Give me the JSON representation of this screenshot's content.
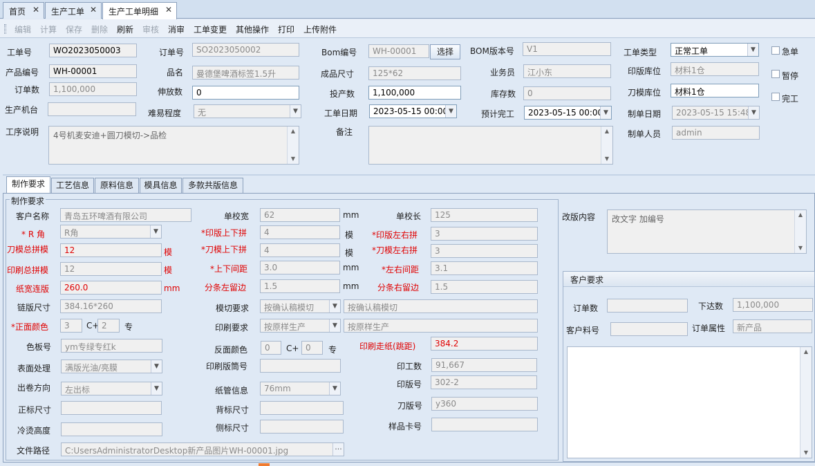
{
  "tabs": [
    {
      "label": "首页",
      "close": "✕"
    },
    {
      "label": "生产工单",
      "close": "✕"
    },
    {
      "label": "生产工单明细",
      "close": "✕"
    }
  ],
  "toolbar": {
    "edit": "编辑",
    "calc": "计算",
    "save": "保存",
    "delete": "删除",
    "refresh": "刷新",
    "audit": "审核",
    "unaudit": "消审",
    "change": "工单变更",
    "other": "其他操作",
    "print": "打印",
    "upload": "上传附件"
  },
  "header": {
    "order_no_label": "工单号",
    "order_no": "WO2023050003",
    "sale_order_label": "订单号",
    "sale_order": "SO2023050002",
    "bom_no_label": "Bom编号",
    "bom_no": "WH-00001",
    "select_button": "选择",
    "bom_version_label": "BOM版本号",
    "bom_version": "V1",
    "order_type_label": "工单类型",
    "order_type": "正常工单",
    "urgent_label": "急单",
    "pause_label": "暂停",
    "done_label": "完工",
    "product_no_label": "产品编号",
    "product_no": "WH-00001",
    "product_name_label": "品名",
    "product_name": "曼德堡啤酒标签1.5升",
    "finish_size_label": "成品尺寸",
    "finish_size": "125*62",
    "salesman_label": "业务员",
    "salesman": "江小东",
    "print_warehouse_label": "印版库位",
    "print_warehouse": "材料1仓",
    "order_qty_label": "订单数",
    "order_qty": "1,100,000",
    "extra_qty_label": "伸放数",
    "extra_qty": "0",
    "produce_qty_label": "投产数",
    "produce_qty": "1,100,000",
    "stock_qty_label": "库存数",
    "stock_qty": "0",
    "die_warehouse_label": "刀模库位",
    "die_warehouse": "材料1仓",
    "machine_label": "生产机台",
    "machine": "",
    "difficulty_label": "难易程度",
    "difficulty": "无",
    "work_date_label": "工单日期",
    "work_date": "2023-05-15 00:00",
    "plan_finish_label": "预计完工",
    "plan_finish": "2023-05-15 00:00",
    "create_date_label": "制单日期",
    "create_date": "2023-05-15 15:48",
    "process_label": "工序说明",
    "process": "4号机麦安迪+圆刀模切->品检",
    "remark_label": "备注",
    "remark": "",
    "creator_label": "制单人员",
    "creator": "admin"
  },
  "subtabs": [
    "制作要求",
    "工艺信息",
    "原料信息",
    "模具信息",
    "多款共版信息"
  ],
  "req": {
    "group_title": "制作要求",
    "customer_label": "客户名称",
    "customer": "青岛五环啤酒有限公司",
    "label_width_label": "单校宽",
    "label_width": "62",
    "mm1": "mm",
    "label_len_label": "单校长",
    "label_len": "125",
    "r_angle_label": "* R 角",
    "r_angle": "R角",
    "print_ud_label": "*印版上下拼",
    "print_ud": "4",
    "mo1": "模",
    "print_lr_label": "*印版左右拼",
    "print_lr": "3",
    "die_total_label": "刀模总拼模",
    "die_total": "12",
    "mo2": "模",
    "die_ud_label": "*刀模上下拼",
    "die_ud": "4",
    "mo3": "模",
    "die_lr_label": "*刀模左右拼",
    "die_lr": "3",
    "print_total_label": "印刷总拼模",
    "print_total": "12",
    "mo4": "模",
    "gap_ud_label": "*上下间距",
    "gap_ud": "3.0",
    "mm2": "mm",
    "gap_lr_label": "*左右间距",
    "gap_lr": "3.1",
    "paper_width_label": "纸宽连版",
    "paper_width": "260.0",
    "mm3": "mm",
    "slit_left_label": "分条左留边",
    "slit_left": "1.5",
    "mm4": "mm",
    "slit_right_label": "分条右留边",
    "slit_right": "1.5",
    "chain_size_label": "链版尺寸",
    "chain_size": "384.16*260",
    "die_req_label": "模切要求",
    "die_req": "按确认稿模切",
    "die_req_text": "按确认稿模切",
    "front_color_label": "*正面颜色",
    "front_color": "3",
    "c_plus1": "C+",
    "front_spot": "2",
    "spot1": "专",
    "print_req_label": "印刷要求",
    "print_req": "按原样生产",
    "print_req_text": "按原样生产",
    "color_plate_label": "色板号",
    "color_plate": "ym专绿专红k",
    "back_color_label": "反面颜色",
    "back_color": "0",
    "c_plus2": "C+",
    "back_spot": "0",
    "spot2": "专",
    "print_feed_label": "印刷走纸(跳距)",
    "print_feed": "384.2",
    "surface_label": "表面处理",
    "surface": "满版光油/亮膜",
    "plate_cyl_label": "印刷版筒号",
    "plate_cyl": "",
    "print_qty_label": "印工数",
    "print_qty": "91,667",
    "unwind_label": "出卷方向",
    "unwind": "左出标",
    "core_label": "纸管信息",
    "core": "76mm",
    "plate_no_label": "印版号",
    "plate_no": "302-2",
    "front_size_label": "正标尺寸",
    "front_size": "",
    "back_size_label": "背标尺寸",
    "back_size": "",
    "die_no_label": "刀版号",
    "die_no": "y360",
    "cold_label": "冷烫高度",
    "cold": "",
    "side_size_label": "侧标尺寸",
    "side_size": "",
    "sample_label": "样品卡号",
    "sample": "",
    "path_label": "文件路径",
    "path": "C:UsersAdministratorDesktop新产品图片WH-00001.jpg",
    "revise_label": "改版内容",
    "revise": "改文字  加编号"
  },
  "cust": {
    "title": "客户要求",
    "order_qty_label": "订单数",
    "order_qty": "",
    "issue_qty_label": "下达数",
    "issue_qty": "1,100,000",
    "cust_part_label": "客户料号",
    "cust_part": "",
    "order_attr_label": "订单属性",
    "order_attr": "新产品"
  }
}
